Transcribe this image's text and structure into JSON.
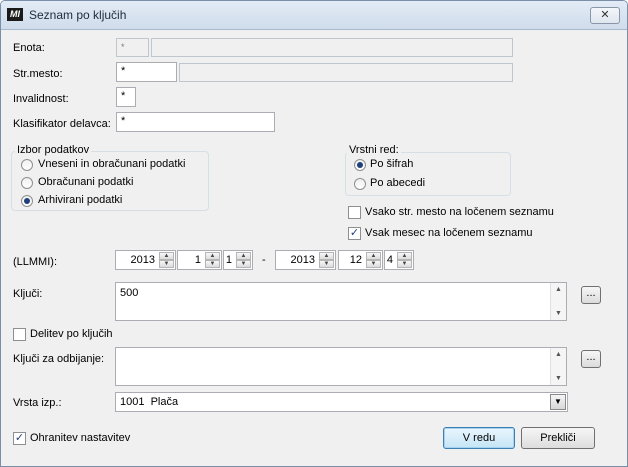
{
  "window": {
    "title": "Seznam po ključih",
    "app_icon": "MI",
    "close_glyph": "✕"
  },
  "fields": {
    "enota": {
      "label": "Enota:",
      "value": "*",
      "desc": ""
    },
    "str_mesto": {
      "label": "Str.mesto:",
      "value": "*",
      "desc": ""
    },
    "invalidnost": {
      "label": "Invalidnost:",
      "value": "*"
    },
    "klasifikator": {
      "label": "Klasifikator delavca:",
      "value": "*"
    }
  },
  "izbor": {
    "legend": "Izbor podatkov",
    "options": [
      {
        "label": "Vneseni in obračunani podatki",
        "selected": false
      },
      {
        "label": "Obračunani podatki",
        "selected": false
      },
      {
        "label": "Arhivirani podatki",
        "selected": true
      }
    ]
  },
  "vrstni_red": {
    "legend": "Vrstni red:",
    "options": [
      {
        "label": "Po šifrah",
        "selected": true
      },
      {
        "label": "Po abecedi",
        "selected": false
      }
    ]
  },
  "checks": {
    "vsako_str_mesto": {
      "label": "Vsako str. mesto na ločenem seznamu",
      "checked": false
    },
    "vsak_mesec": {
      "label": "Vsak mesec na ločenem seznamu",
      "checked": true
    }
  },
  "period": {
    "label": "(LLMMI):",
    "from": {
      "year": "2013",
      "month": "1",
      "index": "1"
    },
    "separator": "-",
    "to": {
      "year": "2013",
      "month": "12",
      "index": "4"
    }
  },
  "kljuci": {
    "label": "Ključi:",
    "value": "500",
    "browse": "..."
  },
  "delitev": {
    "label": "Delitev po ključih",
    "checked": false
  },
  "kljuci_odbijanje": {
    "label": "Ključi za odbijanje:",
    "value": "",
    "browse": "..."
  },
  "vrsta_izp": {
    "label": "Vrsta izp.:",
    "value": "1001  Plača"
  },
  "ohranitev": {
    "label": "Ohranitev nastavitev",
    "checked": true
  },
  "buttons": {
    "ok": "V redu",
    "cancel": "Prekliči"
  },
  "glyphs": {
    "check": "✓",
    "up": "▲",
    "down": "▼"
  }
}
